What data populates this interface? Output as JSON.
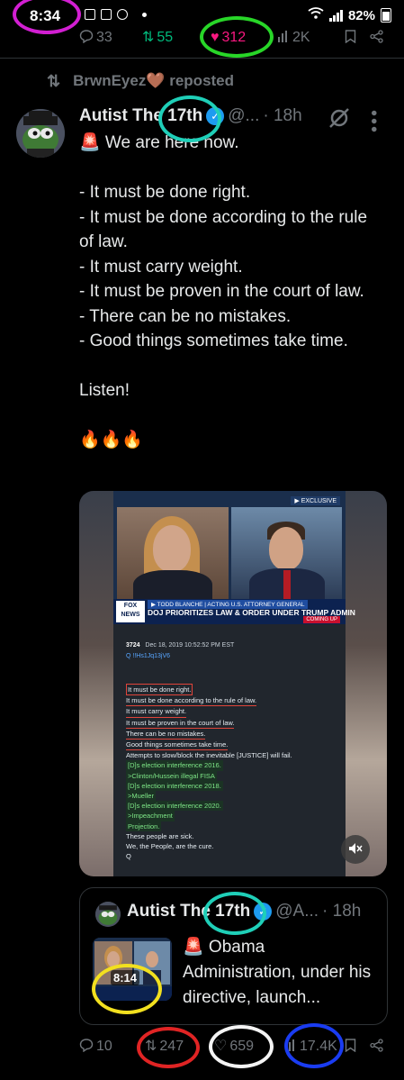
{
  "status_bar": {
    "time": "8:34",
    "battery": "82%"
  },
  "top_actions": {
    "replies": "33",
    "reposts": "55",
    "likes": "312",
    "views": "2K"
  },
  "repost_line": {
    "text": "BrwnEyez🤎 reposted"
  },
  "tweet": {
    "display_name": "Autist The 17th",
    "handle": "@...",
    "time": "· 18h",
    "body": "🚨 We are here now.\n\n- It must be done right.\n- It must be done according to the rule of law.\n- It must carry weight.\n- It must be proven in the court of law.\n- There can be no mistakes.\n- Good things sometimes take time.\n\nListen!\n\n🔥🔥🔥"
  },
  "media": {
    "exclusive_label": "▶ EXCLUSIVE",
    "fox_logo": "FOX NEWS",
    "ticker_top": "▶ TODD BLANCHE | ACTING U.S. ATTORNEY GENERAL",
    "ticker_main": "DOJ PRIORITIZES LAW & ORDER UNDER TRUMP ADMIN",
    "coming_up": "COMING UP",
    "post_number": "3724",
    "post_date": "Dec 18, 2019 10:52:52 PM EST",
    "post_id": "Q !!Hs1Jq13jV6",
    "lines": [
      "It must be done right.",
      "It must be done according to the rule of law.",
      "It must carry weight.",
      "It must be proven in the court of law.",
      "There can be no mistakes.",
      "Good things sometimes take time.",
      "Attempts to slow/block the inevitable [JUSTICE] will fail.",
      "[D]s election interference 2016.",
      ">Clinton/Hussein illegal FISA",
      "[D]s election interference 2018.",
      ">Mueller",
      "[D]s election interference 2020.",
      ">Impeachment",
      "Projection.",
      "These people are sick.",
      "We, the People, are the cure.",
      "Q"
    ]
  },
  "quote": {
    "display_name": "Autist The 17th",
    "handle": "@A...",
    "time": "· 18h",
    "thumb_label": "8:14",
    "text": "🚨 Obama Administration, under his directive, launch..."
  },
  "bottom_actions": {
    "replies": "10",
    "reposts": "247",
    "likes": "659",
    "views": "17.4K"
  },
  "colors": {
    "like": "#f91880",
    "repost": "#00ba7c",
    "verified": "#1d9bf0",
    "muted": "#71767b"
  }
}
